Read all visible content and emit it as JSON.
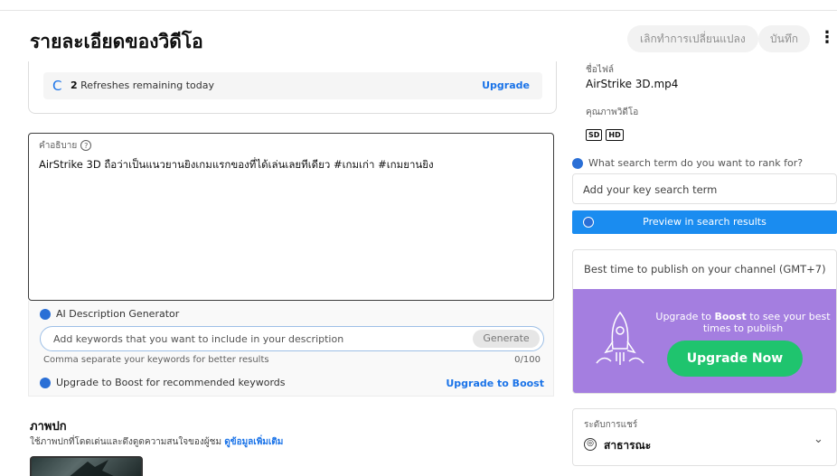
{
  "header": {
    "title": "รายละเอียดของวิดีโอ",
    "undo_label": "เลิกทำการเปลี่ยนแปลง",
    "save_label": "บันทึก",
    "more_icon": "kebab-menu-icon"
  },
  "refresh": {
    "count": "2",
    "text": "Refreshes remaining today",
    "upgrade_label": "Upgrade"
  },
  "description": {
    "label": "คำอธิบาย",
    "value": "AirStrike 3D ถือว่าเป็นแนวยานยิงเกมแรกของที่ได้เล่นเลยทีเดียว #เกมเก่า #เกมยานยิง"
  },
  "ai_generator": {
    "title": "AI Description Generator",
    "placeholder": "Add keywords that you want to include in your description",
    "generate_label": "Generate",
    "hint": "Comma separate your keywords for better results",
    "count": "0/100",
    "boost_text": "Upgrade to Boost for recommended keywords",
    "boost_link": "Upgrade to Boost"
  },
  "thumbnail": {
    "title": "ภาพปก",
    "subtitle": "ใช้ภาพปกที่โดดเด่นและดึงดูดความสนใจของผู้ชม",
    "learn_more": "ดูข้อมูลเพิ่มเติม"
  },
  "file": {
    "label": "ชื่อไฟล์",
    "name": "AirStrike 3D.mp4",
    "quality_label": "คุณภาพวิดีโอ",
    "quality_badges": [
      "SD",
      "HD"
    ]
  },
  "search_rank": {
    "question": "What search term do you want to rank for?",
    "placeholder": "Add your key search term",
    "preview_label": "Preview in search results"
  },
  "best_time": {
    "title": "Best time to publish on your channel (GMT+7)",
    "upgrade_prefix": "Upgrade to ",
    "upgrade_brand": "Boost",
    "upgrade_suffix": " to see your best times to publish",
    "upgrade_now": "Upgrade Now"
  },
  "visibility": {
    "label": "ระดับการแชร์",
    "value": "สาธารณะ"
  },
  "colors": {
    "accent_blue": "#1a73e8",
    "preview_blue": "#1a8cf0",
    "purple": "#a47ee0",
    "green": "#1fc46e"
  }
}
